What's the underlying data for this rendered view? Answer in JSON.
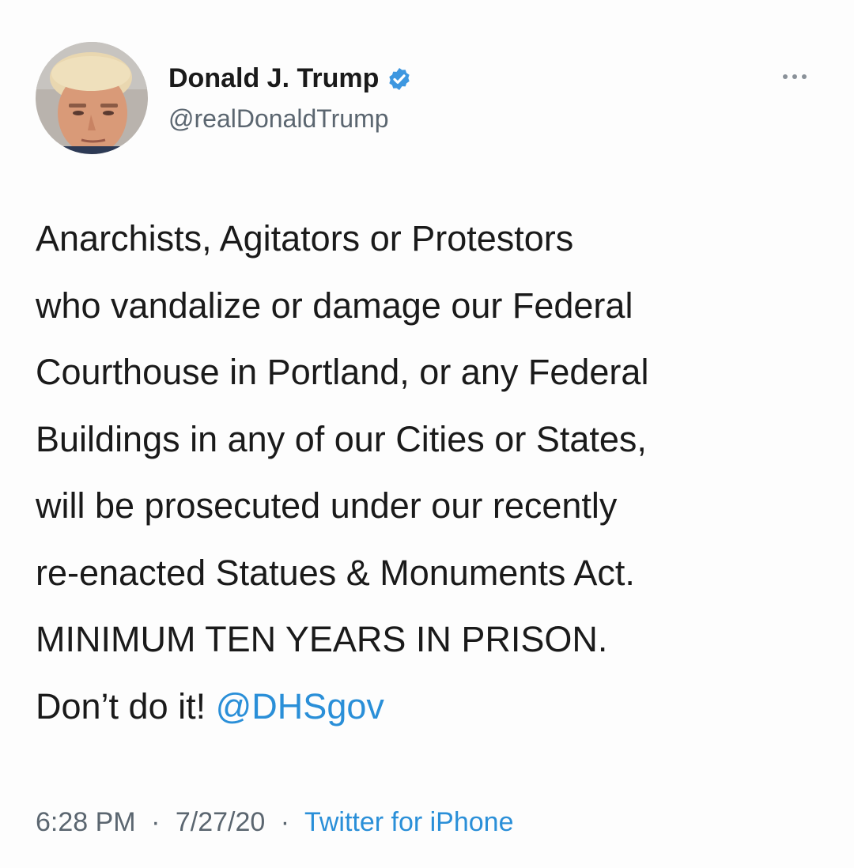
{
  "author": {
    "name": "Donald J. Trump",
    "handle": "@realDonaldTrump",
    "verified": true
  },
  "tweet": {
    "lines": [
      "Anarchists, Agitators or Protestors",
      "who vandalize or damage our Federal",
      "Courthouse in Portland, or any Federal",
      "Buildings in any of our Cities or States,",
      "will be prosecuted under our recently",
      "re-enacted Statues & Monuments Act.",
      "MINIMUM TEN YEARS IN PRISON."
    ],
    "last_line_text": "Don’t do it! ",
    "mention": "@DHSgov"
  },
  "meta": {
    "time": "6:28 PM",
    "separator": "·",
    "date": "7/27/20",
    "source": "Twitter for iPhone"
  },
  "icons": {
    "verified": "verified-badge-icon",
    "more": "more-options-icon"
  },
  "colors": {
    "link": "#2a8fd8",
    "verified": "#3d97e0",
    "secondary_text": "#5b6670"
  }
}
